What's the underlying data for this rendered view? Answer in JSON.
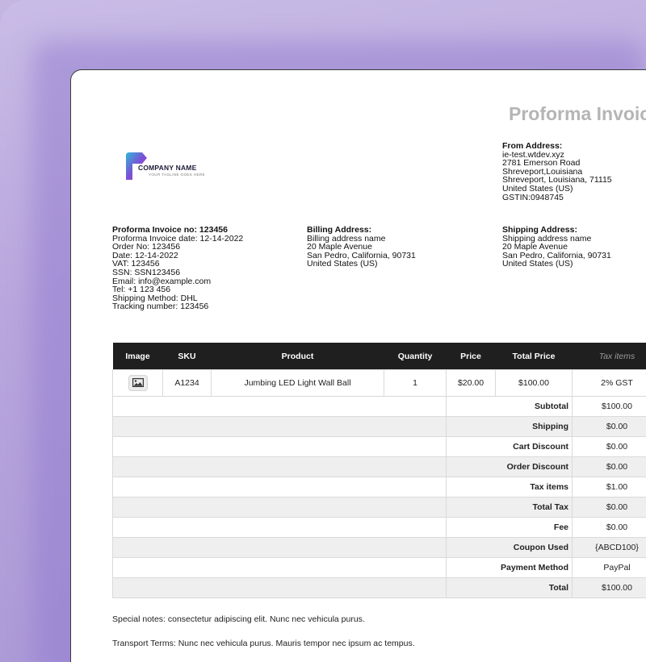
{
  "document": {
    "title": "Proforma Invoice",
    "company": {
      "name": "COMPANY NAME",
      "tagline": "YOUR TAGLINE GOES HERE"
    },
    "from_address": {
      "heading": "From Address:",
      "lines": [
        "ie-test.wtdev.xyz",
        "2781 Emerson Road",
        "Shreveport,Louisiana",
        "Shreveport, Louisiana, 71115",
        "United States (US)",
        "GSTIN:0948745"
      ]
    },
    "invoice_info": {
      "heading": "Proforma Invoice no: 123456",
      "lines": [
        "Proforma Invoice date: 12-14-2022",
        "Order No: 123456",
        "Date: 12-14-2022",
        "VAT: 123456",
        "SSN: SSN123456",
        "Email: info@example.com",
        "Tel: +1 123 456",
        "Shipping Method: DHL",
        "Tracking number: 123456"
      ]
    },
    "billing_address": {
      "heading": "Billing Address:",
      "lines": [
        "Billing address name",
        "20 Maple Avenue",
        "San Pedro, California, 90731",
        "United States (US)"
      ]
    },
    "shipping_address": {
      "heading": "Shipping Address:",
      "lines": [
        "Shipping address name",
        "20 Maple Avenue",
        "San Pedro, California, 90731",
        "United States (US)"
      ]
    },
    "table": {
      "headers": [
        "Image",
        "SKU",
        "Product",
        "Quantity",
        "Price",
        "Total Price",
        "Tax items"
      ],
      "row": {
        "image_icon": "image-icon",
        "sku": "A1234",
        "product": "Jumbing LED Light Wall Ball",
        "quantity": "1",
        "price": "$20.00",
        "total_price": "$100.00",
        "tax": "2% GST"
      },
      "summary": [
        {
          "label": "Subtotal",
          "value": "$100.00"
        },
        {
          "label": "Shipping",
          "value": "$0.00"
        },
        {
          "label": "Cart Discount",
          "value": "$0.00"
        },
        {
          "label": "Order Discount",
          "value": "$0.00"
        },
        {
          "label": "Tax items",
          "value": "$1.00"
        },
        {
          "label": "Total Tax",
          "value": "$0.00"
        },
        {
          "label": "Fee",
          "value": "$0.00"
        },
        {
          "label": "Coupon Used",
          "value": "{ABCD100}"
        },
        {
          "label": "Payment Method",
          "value": "PayPal"
        },
        {
          "label": "Total",
          "value": "$100.00"
        }
      ]
    },
    "special_notes": "Special notes: consectetur adipiscing elit. Nunc nec vehicula purus.",
    "transport_terms": "Transport Terms: Nunc nec vehicula purus. Mauris tempor nec ipsum ac tempus."
  },
  "colors": {
    "header_bg": "#1f1f1f",
    "title": "#b5b5b5",
    "frame_bg": "#b8a6dd"
  }
}
